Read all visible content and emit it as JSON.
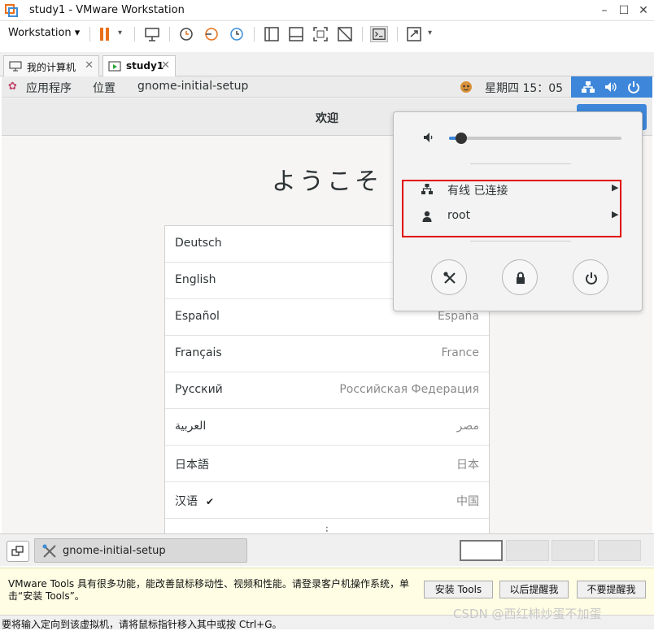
{
  "window": {
    "title": "study1 - VMware Workstation"
  },
  "toolbar": {
    "workstation_menu": "Workstation"
  },
  "vm_tabs": [
    {
      "label": "我的计算机"
    },
    {
      "label": "study1"
    }
  ],
  "gnome_topbar": {
    "apps": "应用程序",
    "places": "位置",
    "active_app": "gnome-initial-setup",
    "clock": "星期四 15：05"
  },
  "setup": {
    "header_title": "欢迎",
    "greeting": "ようこそ",
    "languages": [
      {
        "name": "Deutsch",
        "region": ""
      },
      {
        "name": "English",
        "region": ""
      },
      {
        "name": "Español",
        "region": "España"
      },
      {
        "name": "Français",
        "region": "France"
      },
      {
        "name": "Русский",
        "region": "Российская Федерация"
      },
      {
        "name": "العربية",
        "region": "مصر"
      },
      {
        "name": "日本語",
        "region": "日本"
      },
      {
        "name": "汉语",
        "region": "中国"
      }
    ],
    "selected_language": "汉语"
  },
  "system_menu": {
    "volume": 0.07,
    "wired": "有线 已连接",
    "user": "root"
  },
  "bottom": {
    "task_label": "gnome-initial-setup"
  },
  "notice": {
    "text": "VMware Tools 具有很多功能，能改善鼠标移动性、视频和性能。请登录客户机操作系统，单击“安装 Tools”。",
    "install": "安装 Tools",
    "remind_later": "以后提醒我",
    "never_remind": "不要提醒我"
  },
  "statusbar": {
    "text": "要将输入定向到该虚拟机，请将鼠标指针移入其中或按 Ctrl+G。"
  },
  "watermark": "CSDN @西红柿炒蛋不加蛋",
  "colors": {
    "gnome_blue": "#3d86d9",
    "highlight_red": "#e00000",
    "pause_orange": "#e8701a"
  }
}
